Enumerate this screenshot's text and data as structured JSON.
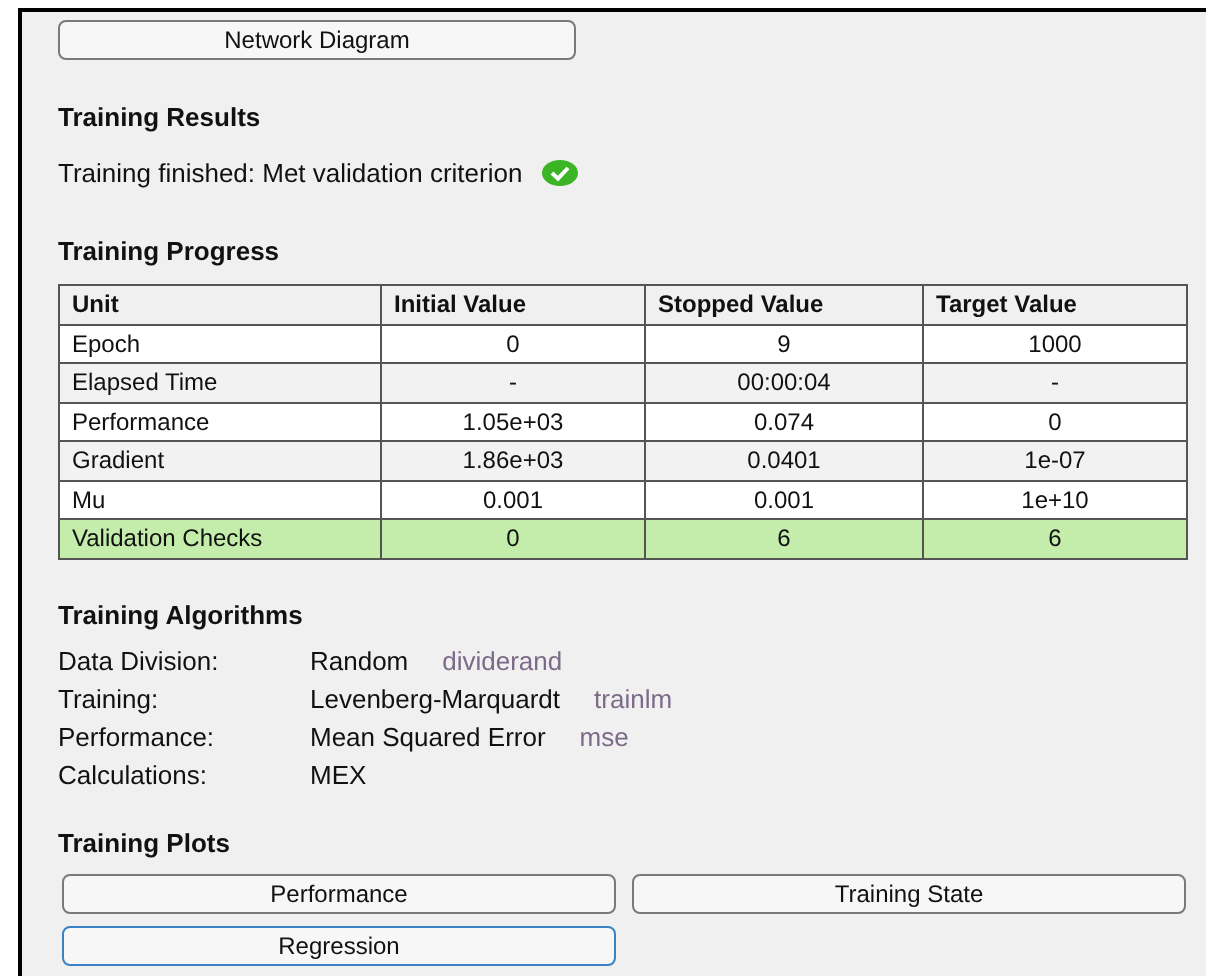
{
  "network_button": {
    "label": "Network Diagram"
  },
  "training_results": {
    "title": "Training Results",
    "status": "Training finished: Met validation criterion",
    "success": true
  },
  "training_progress": {
    "title": "Training Progress",
    "columns": [
      "Unit",
      "Initial Value",
      "Stopped Value",
      "Target Value"
    ],
    "rows": [
      {
        "cells": [
          "Epoch",
          "0",
          "9",
          "1000"
        ],
        "highlighted": false
      },
      {
        "cells": [
          "Elapsed Time",
          "-",
          "00:00:04",
          "-"
        ],
        "highlighted": false
      },
      {
        "cells": [
          "Performance",
          "1.05e+03",
          "0.074",
          "0"
        ],
        "highlighted": false
      },
      {
        "cells": [
          "Gradient",
          "1.86e+03",
          "0.0401",
          "1e-07"
        ],
        "highlighted": false
      },
      {
        "cells": [
          "Mu",
          "0.001",
          "0.001",
          "1e+10"
        ],
        "highlighted": false
      },
      {
        "cells": [
          "Validation Checks",
          "0",
          "6",
          "6"
        ],
        "highlighted": true
      }
    ]
  },
  "training_algorithms": {
    "title": "Training Algorithms",
    "items": [
      {
        "label": "Data Division:",
        "value": "Random",
        "function": "dividerand"
      },
      {
        "label": "Training:",
        "value": "Levenberg-Marquardt",
        "function": "trainlm"
      },
      {
        "label": "Performance:",
        "value": "Mean Squared Error",
        "function": "mse"
      },
      {
        "label": "Calculations:",
        "value": "MEX"
      }
    ]
  },
  "training_plots": {
    "title": "Training Plots",
    "buttons": [
      {
        "label": "Performance",
        "focused": false
      },
      {
        "label": "Training State",
        "focused": false
      },
      {
        "label": "Regression",
        "focused": true
      }
    ]
  }
}
